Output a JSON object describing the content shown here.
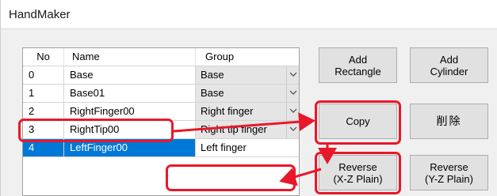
{
  "window": {
    "title": "HandMaker"
  },
  "grid": {
    "columns": [
      "No",
      "Name",
      "Group"
    ],
    "rows": [
      {
        "no": "0",
        "name": "Base",
        "group": "Base"
      },
      {
        "no": "1",
        "name": "Base01",
        "group": "Base"
      },
      {
        "no": "2",
        "name": "RightFinger00",
        "group": "Right finger"
      },
      {
        "no": "3",
        "name": "RightTip00",
        "group": "Right tip finger"
      },
      {
        "no": "4",
        "name": "LeftFinger00",
        "group": "Left finger"
      }
    ],
    "selected_row": 4
  },
  "buttons": {
    "add_rectangle": "Add\nRectangle",
    "add_cylinder": "Add\nCylinder",
    "copy": "Copy",
    "delete": "削除",
    "reverse_xz": "Reverse\n(X-Z Plain)",
    "reverse_yz": "Reverse\n(Y-Z Plain)"
  },
  "colors": {
    "annotation": "#e8182a",
    "selection": "#0078d7"
  }
}
